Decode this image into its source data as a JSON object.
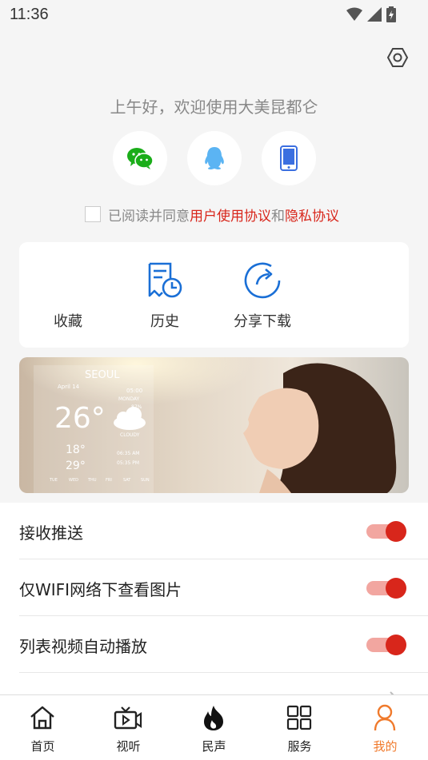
{
  "status_bar": {
    "time": "11:36"
  },
  "greeting": "上午好，欢迎使用大美昆都仑",
  "login_methods": [
    {
      "name": "wechat",
      "icon": "wechat-icon",
      "color": "#1aad19"
    },
    {
      "name": "qq",
      "icon": "qq-icon",
      "color": "#5bb4f3"
    },
    {
      "name": "phone",
      "icon": "phone-icon",
      "color": "#3b6fe0"
    }
  ],
  "agreement": {
    "prefix": "已阅读并同意",
    "user_agreement": "用户使用协议",
    "conjunction": "和",
    "privacy_agreement": "隐私协议",
    "checked": false
  },
  "quick_actions": [
    {
      "label": "收藏",
      "icon": "favorite-icon"
    },
    {
      "label": "历史",
      "icon": "history-icon"
    },
    {
      "label": "分享下载",
      "icon": "share-icon"
    }
  ],
  "banner": {
    "city": "SEOUL",
    "date": "April 14",
    "time": "05:00",
    "day": "MONDAY",
    "humidity": "87%",
    "temperature": "26°",
    "condition": "CLOUDY",
    "low": "18°",
    "high": "29°",
    "sunrise": "06:35 AM",
    "sunset": "05:35 PM",
    "weekdays": [
      "TUE",
      "WED",
      "THU",
      "FRI",
      "SAT",
      "SUN"
    ]
  },
  "settings": [
    {
      "label": "接收推送",
      "enabled": true
    },
    {
      "label": "仅WIFI网络下查看图片",
      "enabled": true
    },
    {
      "label": "列表视频自动播放",
      "enabled": true
    }
  ],
  "tabs": [
    {
      "label": "首页",
      "icon": "home-icon",
      "active": false
    },
    {
      "label": "视听",
      "icon": "video-icon",
      "active": false
    },
    {
      "label": "民声",
      "icon": "flame-icon",
      "active": false
    },
    {
      "label": "服务",
      "icon": "grid-icon",
      "active": false
    },
    {
      "label": "我的",
      "icon": "profile-icon",
      "active": true
    }
  ],
  "colors": {
    "accent_red": "#d8261b",
    "active_tab": "#f07a2c",
    "quick_icon_blue": "#1a6fd6"
  }
}
